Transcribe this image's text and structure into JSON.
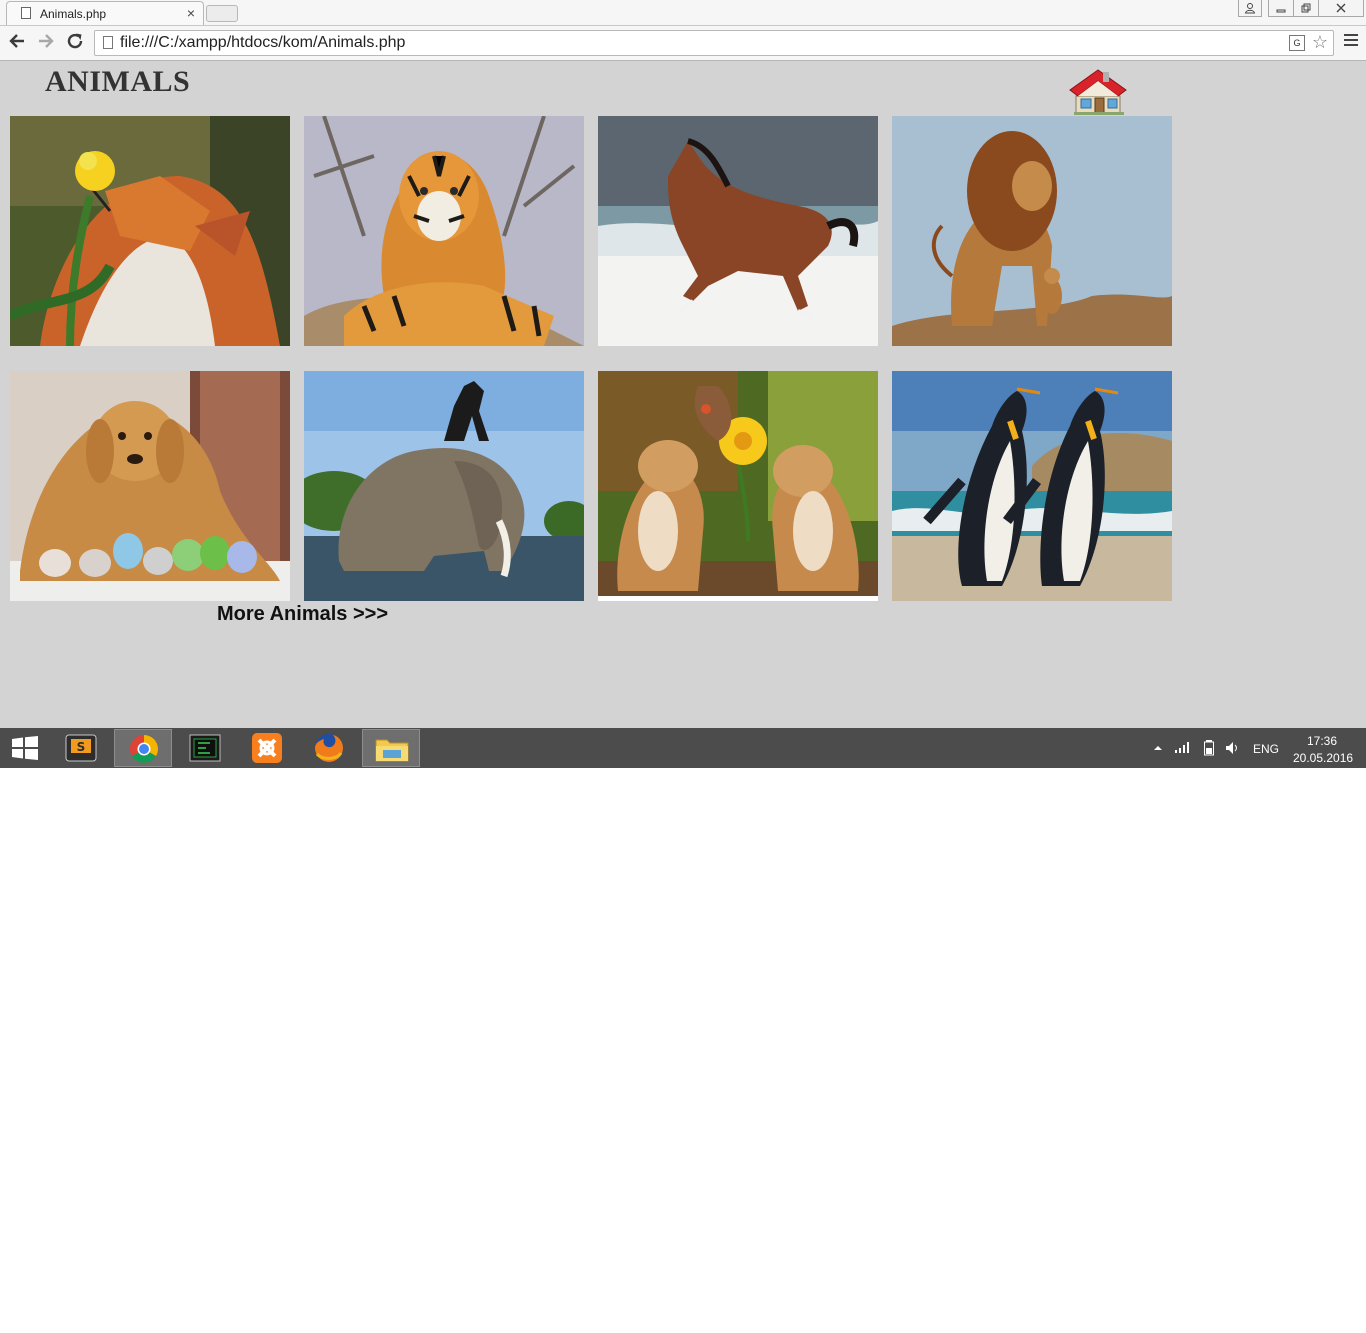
{
  "browser": {
    "tab_title": "Animals.php",
    "tab_close": "×",
    "url": "file:///C:/xampp/htdocs/kom/Animals.php",
    "back_icon": "arrow-left-icon",
    "forward_icon": "arrow-right-icon",
    "reload_icon": "reload-icon",
    "translate_icon": "translate-icon",
    "bookmark_icon": "star-icon",
    "menu_icon": "hamburger-menu-icon",
    "window_controls": [
      "user-icon",
      "minimize-icon",
      "restore-icon",
      "close-icon"
    ]
  },
  "page": {
    "background": "#d3d3d3",
    "title": "ANIMALS",
    "home_icon": "house-icon",
    "gallery": [
      {
        "subject": "fox-photo"
      },
      {
        "subject": "tiger-photo"
      },
      {
        "subject": "horse-photo"
      },
      {
        "subject": "lion-photo"
      },
      {
        "subject": "dog-and-birds-photo"
      },
      {
        "subject": "elephant-photo"
      },
      {
        "subject": "hamsters-photo"
      },
      {
        "subject": "penguins-photo"
      }
    ],
    "more_link": "More Animals >>>"
  },
  "taskbar": {
    "apps": [
      "sublime-text-icon",
      "chrome-icon",
      "terminal-icon",
      "xampp-icon",
      "firefox-icon",
      "file-explorer-icon"
    ],
    "active_app": "chrome-icon",
    "language": "ENG",
    "time": "17:36",
    "date": "20.05.2016"
  }
}
